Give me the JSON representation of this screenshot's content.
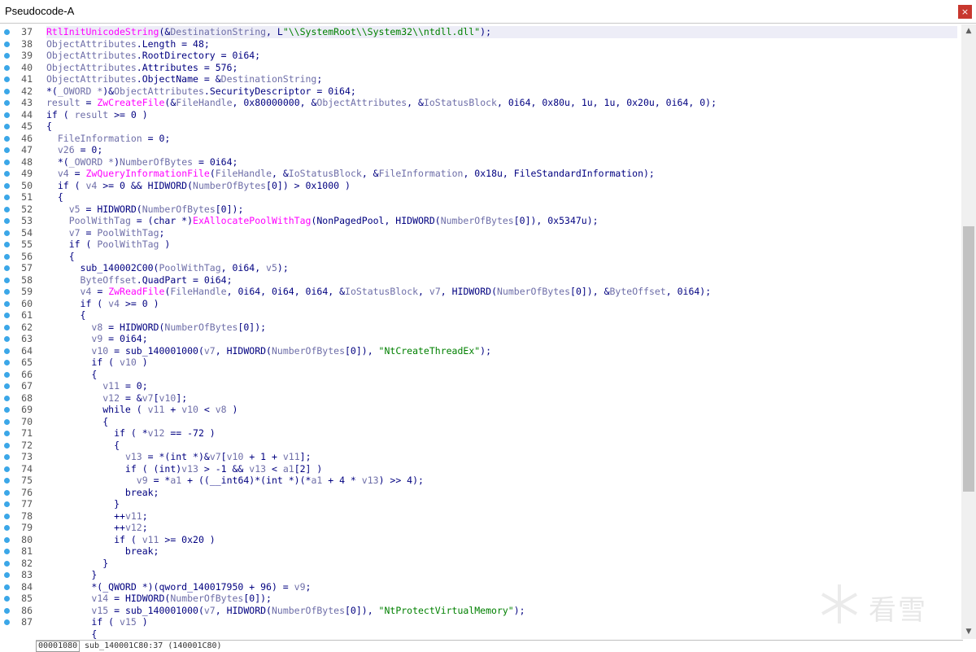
{
  "window": {
    "title": "Pseudocode-A",
    "close_label": "×"
  },
  "colors": {
    "plain": "#000080",
    "variable": "#6e6ea8",
    "function": "#ff00ff",
    "string": "#008000",
    "numeric": "#000080",
    "line_dot": "#3ba7e8"
  },
  "code_lines": [
    {
      "num": "37",
      "highlight": true,
      "tokens": [
        [
          "f",
          "RtlInitUnicodeString"
        ],
        [
          "p",
          "(&"
        ],
        [
          "v",
          "DestinationString"
        ],
        [
          "p",
          ", L"
        ],
        [
          "s",
          "\"\\\\SystemRoot\\\\System32\\\\ntdll.dll\""
        ],
        [
          "p",
          ");"
        ]
      ]
    },
    {
      "num": "38",
      "tokens": [
        [
          "v",
          "ObjectAttributes"
        ],
        [
          "p",
          ".Length = 48;"
        ]
      ]
    },
    {
      "num": "39",
      "tokens": [
        [
          "v",
          "ObjectAttributes"
        ],
        [
          "p",
          ".RootDirectory = 0i64;"
        ]
      ]
    },
    {
      "num": "40",
      "tokens": [
        [
          "v",
          "ObjectAttributes"
        ],
        [
          "p",
          ".Attributes = 576;"
        ]
      ]
    },
    {
      "num": "41",
      "tokens": [
        [
          "v",
          "ObjectAttributes"
        ],
        [
          "p",
          ".ObjectName = &"
        ],
        [
          "v",
          "DestinationString"
        ],
        [
          "p",
          ";"
        ]
      ]
    },
    {
      "num": "42",
      "tokens": [
        [
          "p",
          "*("
        ],
        [
          "v",
          "_OWORD *"
        ],
        [
          "p",
          ")&"
        ],
        [
          "v",
          "ObjectAttributes"
        ],
        [
          "p",
          ".SecurityDescriptor = 0i64;"
        ]
      ]
    },
    {
      "num": "43",
      "tokens": [
        [
          "v",
          "result"
        ],
        [
          "p",
          " = "
        ],
        [
          "f",
          "ZwCreateFile"
        ],
        [
          "p",
          "(&"
        ],
        [
          "v",
          "FileHandle"
        ],
        [
          "p",
          ", 0x80000000, &"
        ],
        [
          "v",
          "ObjectAttributes"
        ],
        [
          "p",
          ", &"
        ],
        [
          "v",
          "IoStatusBlock"
        ],
        [
          "p",
          ", 0i64, 0x80u, 1u, 1u, 0x20u, 0i64, 0);"
        ]
      ]
    },
    {
      "num": "44",
      "tokens": [
        [
          "p",
          "if ( "
        ],
        [
          "v",
          "result"
        ],
        [
          "p",
          " >= 0 )"
        ]
      ]
    },
    {
      "num": "45",
      "tokens": [
        [
          "p",
          "{"
        ]
      ]
    },
    {
      "num": "46",
      "tokens": [
        [
          "p",
          "  "
        ],
        [
          "v",
          "FileInformation"
        ],
        [
          "p",
          " = 0;"
        ]
      ]
    },
    {
      "num": "47",
      "tokens": [
        [
          "p",
          "  "
        ],
        [
          "v",
          "v26"
        ],
        [
          "p",
          " = 0;"
        ]
      ]
    },
    {
      "num": "48",
      "tokens": [
        [
          "p",
          "  *("
        ],
        [
          "v",
          "_OWORD *"
        ],
        [
          "p",
          ")"
        ],
        [
          "v",
          "NumberOfBytes"
        ],
        [
          "p",
          " = 0i64;"
        ]
      ]
    },
    {
      "num": "49",
      "tokens": [
        [
          "p",
          "  "
        ],
        [
          "v",
          "v4"
        ],
        [
          "p",
          " = "
        ],
        [
          "f",
          "ZwQueryInformationFile"
        ],
        [
          "p",
          "("
        ],
        [
          "v",
          "FileHandle"
        ],
        [
          "p",
          ", &"
        ],
        [
          "v",
          "IoStatusBlock"
        ],
        [
          "p",
          ", &"
        ],
        [
          "v",
          "FileInformation"
        ],
        [
          "p",
          ", 0x18u, FileStandardInformation);"
        ]
      ]
    },
    {
      "num": "50",
      "tokens": [
        [
          "p",
          "  if ( "
        ],
        [
          "v",
          "v4"
        ],
        [
          "p",
          " >= 0 && HIDWORD("
        ],
        [
          "v",
          "NumberOfBytes"
        ],
        [
          "p",
          "[0]) > 0x1000 )"
        ]
      ]
    },
    {
      "num": "51",
      "tokens": [
        [
          "p",
          "  {"
        ]
      ]
    },
    {
      "num": "52",
      "tokens": [
        [
          "p",
          "    "
        ],
        [
          "v",
          "v5"
        ],
        [
          "p",
          " = HIDWORD("
        ],
        [
          "v",
          "NumberOfBytes"
        ],
        [
          "p",
          "[0]);"
        ]
      ]
    },
    {
      "num": "53",
      "tokens": [
        [
          "p",
          "    "
        ],
        [
          "v",
          "PoolWithTag"
        ],
        [
          "p",
          " = (char *)"
        ],
        [
          "f",
          "ExAllocatePoolWithTag"
        ],
        [
          "p",
          "(NonPagedPool, HIDWORD("
        ],
        [
          "v",
          "NumberOfBytes"
        ],
        [
          "p",
          "[0]), 0x5347u);"
        ]
      ]
    },
    {
      "num": "54",
      "tokens": [
        [
          "p",
          "    "
        ],
        [
          "v",
          "v7"
        ],
        [
          "p",
          " = "
        ],
        [
          "v",
          "PoolWithTag"
        ],
        [
          "p",
          ";"
        ]
      ]
    },
    {
      "num": "55",
      "tokens": [
        [
          "p",
          "    if ( "
        ],
        [
          "v",
          "PoolWithTag"
        ],
        [
          "p",
          " )"
        ]
      ]
    },
    {
      "num": "56",
      "tokens": [
        [
          "p",
          "    {"
        ]
      ]
    },
    {
      "num": "57",
      "tokens": [
        [
          "p",
          "      sub_140002C00("
        ],
        [
          "v",
          "PoolWithTag"
        ],
        [
          "p",
          ", 0i64, "
        ],
        [
          "v",
          "v5"
        ],
        [
          "p",
          ");"
        ]
      ]
    },
    {
      "num": "58",
      "tokens": [
        [
          "p",
          "      "
        ],
        [
          "v",
          "ByteOffset"
        ],
        [
          "p",
          ".QuadPart = 0i64;"
        ]
      ]
    },
    {
      "num": "59",
      "tokens": [
        [
          "p",
          "      "
        ],
        [
          "v",
          "v4"
        ],
        [
          "p",
          " = "
        ],
        [
          "f",
          "ZwReadFile"
        ],
        [
          "p",
          "("
        ],
        [
          "v",
          "FileHandle"
        ],
        [
          "p",
          ", 0i64, 0i64, 0i64, &"
        ],
        [
          "v",
          "IoStatusBlock"
        ],
        [
          "p",
          ", "
        ],
        [
          "v",
          "v7"
        ],
        [
          "p",
          ", HIDWORD("
        ],
        [
          "v",
          "NumberOfBytes"
        ],
        [
          "p",
          "[0]), &"
        ],
        [
          "v",
          "ByteOffset"
        ],
        [
          "p",
          ", 0i64);"
        ]
      ]
    },
    {
      "num": "60",
      "tokens": [
        [
          "p",
          "      if ( "
        ],
        [
          "v",
          "v4"
        ],
        [
          "p",
          " >= 0 )"
        ]
      ]
    },
    {
      "num": "61",
      "tokens": [
        [
          "p",
          "      {"
        ]
      ]
    },
    {
      "num": "62",
      "tokens": [
        [
          "p",
          "        "
        ],
        [
          "v",
          "v8"
        ],
        [
          "p",
          " = HIDWORD("
        ],
        [
          "v",
          "NumberOfBytes"
        ],
        [
          "p",
          "[0]);"
        ]
      ]
    },
    {
      "num": "63",
      "tokens": [
        [
          "p",
          "        "
        ],
        [
          "v",
          "v9"
        ],
        [
          "p",
          " = 0i64;"
        ]
      ]
    },
    {
      "num": "64",
      "tokens": [
        [
          "p",
          "        "
        ],
        [
          "v",
          "v10"
        ],
        [
          "p",
          " = sub_140001000("
        ],
        [
          "v",
          "v7"
        ],
        [
          "p",
          ", HIDWORD("
        ],
        [
          "v",
          "NumberOfBytes"
        ],
        [
          "p",
          "[0]), "
        ],
        [
          "s",
          "\"NtCreateThreadEx\""
        ],
        [
          "p",
          ");"
        ]
      ]
    },
    {
      "num": "65",
      "tokens": [
        [
          "p",
          "        if ( "
        ],
        [
          "v",
          "v10"
        ],
        [
          "p",
          " )"
        ]
      ]
    },
    {
      "num": "66",
      "tokens": [
        [
          "p",
          "        {"
        ]
      ]
    },
    {
      "num": "67",
      "tokens": [
        [
          "p",
          "          "
        ],
        [
          "v",
          "v11"
        ],
        [
          "p",
          " = 0;"
        ]
      ]
    },
    {
      "num": "68",
      "tokens": [
        [
          "p",
          "          "
        ],
        [
          "v",
          "v12"
        ],
        [
          "p",
          " = &"
        ],
        [
          "v",
          "v7"
        ],
        [
          "p",
          "["
        ],
        [
          "v",
          "v10"
        ],
        [
          "p",
          "];"
        ]
      ]
    },
    {
      "num": "69",
      "tokens": [
        [
          "p",
          "          while ( "
        ],
        [
          "v",
          "v11"
        ],
        [
          "p",
          " + "
        ],
        [
          "v",
          "v10"
        ],
        [
          "p",
          " < "
        ],
        [
          "v",
          "v8"
        ],
        [
          "p",
          " )"
        ]
      ]
    },
    {
      "num": "70",
      "tokens": [
        [
          "p",
          "          {"
        ]
      ]
    },
    {
      "num": "71",
      "tokens": [
        [
          "p",
          "            if ( *"
        ],
        [
          "v",
          "v12"
        ],
        [
          "p",
          " == -72 )"
        ]
      ]
    },
    {
      "num": "72",
      "tokens": [
        [
          "p",
          "            {"
        ]
      ]
    },
    {
      "num": "73",
      "tokens": [
        [
          "p",
          "              "
        ],
        [
          "v",
          "v13"
        ],
        [
          "p",
          " = *(int *)&"
        ],
        [
          "v",
          "v7"
        ],
        [
          "p",
          "["
        ],
        [
          "v",
          "v10"
        ],
        [
          "p",
          " + 1 + "
        ],
        [
          "v",
          "v11"
        ],
        [
          "p",
          "];"
        ]
      ]
    },
    {
      "num": "74",
      "tokens": [
        [
          "p",
          "              if ( (int)"
        ],
        [
          "v",
          "v13"
        ],
        [
          "p",
          " > -1 && "
        ],
        [
          "v",
          "v13"
        ],
        [
          "p",
          " < "
        ],
        [
          "v",
          "a1"
        ],
        [
          "p",
          "[2] )"
        ]
      ]
    },
    {
      "num": "75",
      "tokens": [
        [
          "p",
          "                "
        ],
        [
          "v",
          "v9"
        ],
        [
          "p",
          " = *"
        ],
        [
          "v",
          "a1"
        ],
        [
          "p",
          " + ((__int64)*(int *)(*"
        ],
        [
          "v",
          "a1"
        ],
        [
          "p",
          " + 4 * "
        ],
        [
          "v",
          "v13"
        ],
        [
          "p",
          ") >> 4);"
        ]
      ]
    },
    {
      "num": "76",
      "tokens": [
        [
          "p",
          "              break;"
        ]
      ]
    },
    {
      "num": "77",
      "tokens": [
        [
          "p",
          "            }"
        ]
      ]
    },
    {
      "num": "78",
      "tokens": [
        [
          "p",
          "            ++"
        ],
        [
          "v",
          "v11"
        ],
        [
          "p",
          ";"
        ]
      ]
    },
    {
      "num": "79",
      "tokens": [
        [
          "p",
          "            ++"
        ],
        [
          "v",
          "v12"
        ],
        [
          "p",
          ";"
        ]
      ]
    },
    {
      "num": "80",
      "tokens": [
        [
          "p",
          "            if ( "
        ],
        [
          "v",
          "v11"
        ],
        [
          "p",
          " >= 0x20 )"
        ]
      ]
    },
    {
      "num": "81",
      "tokens": [
        [
          "p",
          "              break;"
        ]
      ]
    },
    {
      "num": "82",
      "tokens": [
        [
          "p",
          "          }"
        ]
      ]
    },
    {
      "num": "83",
      "tokens": [
        [
          "p",
          "        }"
        ]
      ]
    },
    {
      "num": "84",
      "tokens": [
        [
          "p",
          "        *(_QWORD *)(qword_140017950 + 96) = "
        ],
        [
          "v",
          "v9"
        ],
        [
          "p",
          ";"
        ]
      ]
    },
    {
      "num": "85",
      "tokens": [
        [
          "p",
          "        "
        ],
        [
          "v",
          "v14"
        ],
        [
          "p",
          " = HIDWORD("
        ],
        [
          "v",
          "NumberOfBytes"
        ],
        [
          "p",
          "[0]);"
        ]
      ]
    },
    {
      "num": "86",
      "tokens": [
        [
          "p",
          "        "
        ],
        [
          "v",
          "v15"
        ],
        [
          "p",
          " = sub_140001000("
        ],
        [
          "v",
          "v7"
        ],
        [
          "p",
          ", HIDWORD("
        ],
        [
          "v",
          "NumberOfBytes"
        ],
        [
          "p",
          "[0]), "
        ],
        [
          "s",
          "\"NtProtectVirtualMemory\""
        ],
        [
          "p",
          ");"
        ]
      ]
    },
    {
      "num": "87",
      "tokens": [
        [
          "p",
          "        if ( "
        ],
        [
          "v",
          "v15"
        ],
        [
          "p",
          " )"
        ]
      ]
    }
  ],
  "partial_line": "        {",
  "status": {
    "address": "00001080",
    "location": "sub_140001C80:37 (140001C80)"
  },
  "scrollbar": {
    "position_fraction": 0.33
  },
  "watermark": {
    "text": "看雪"
  }
}
